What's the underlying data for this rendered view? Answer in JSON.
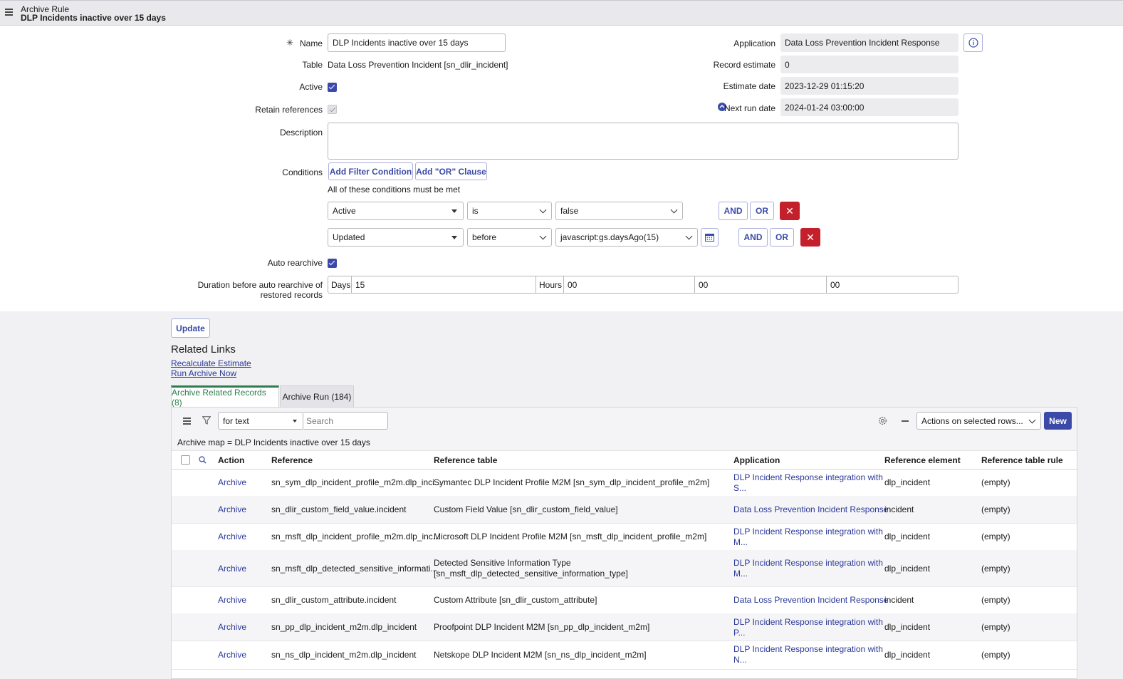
{
  "header": {
    "title_line1": "Archive Rule",
    "title_line2": "DLP Incidents inactive over 15 days",
    "menu_icon": "hamburger-menu-icon"
  },
  "form": {
    "required_marker": "✳",
    "name_label": "Name",
    "name_value": "DLP Incidents inactive over 15 days",
    "table_label": "Table",
    "table_value": "Data Loss Prevention Incident [sn_dlir_incident]",
    "active_label": "Active",
    "active_checked": true,
    "retain_label": "Retain references",
    "retain_checked": true,
    "description_label": "Description",
    "description_value": "",
    "application_label": "Application",
    "application_value": "Data Loss Prevention Incident Response",
    "record_estimate_label": "Record estimate",
    "record_estimate_value": "0",
    "estimate_date_label": "Estimate date",
    "estimate_date_value": "2023-12-29 01:15:20",
    "next_run_label": "Next run date",
    "next_run_value": "2024-01-24 03:00:00",
    "conditions_label": "Conditions",
    "add_filter_label": "Add Filter Condition",
    "add_or_label": "Add \"OR\" Clause",
    "conditions_note": "All of these conditions must be met",
    "conditions": [
      {
        "field": "Active",
        "operator": "is",
        "value": "false"
      },
      {
        "field": "Updated",
        "operator": "before",
        "value": "javascript:gs.daysAgo(15)"
      }
    ],
    "and_label": "AND",
    "or_label": "OR",
    "remove_icon": "✕",
    "auto_rearchive_label": "Auto rearchive",
    "auto_rearchive_checked": true,
    "duration_label_line1": "Duration before auto rearchive of",
    "duration_label_line2": "restored records",
    "days_label": "Days",
    "days_value": "15",
    "hours_label": "Hours",
    "hours_value": "00",
    "minutes_value": "00",
    "seconds_value": "00"
  },
  "update_label": "Update",
  "related_links": {
    "title": "Related Links",
    "links": [
      "Recalculate Estimate",
      "Run Archive Now"
    ]
  },
  "tabs": [
    {
      "label": "Archive Related Records (8)"
    },
    {
      "label": "Archive Run (184)"
    }
  ],
  "list": {
    "search_field": "for text",
    "search_placeholder": "Search",
    "actions_select": "Actions on selected rows...",
    "new_label": "New",
    "breadcrumb": "Archive map = DLP Incidents inactive over 15 days",
    "columns": [
      "Action",
      "Reference",
      "Reference table",
      "Application",
      "Reference element",
      "Reference table rule"
    ],
    "rows": [
      {
        "action": "Archive",
        "reference": "sn_sym_dlp_incident_profile_m2m.dlp_inci...",
        "ref_table": "Symantec DLP Incident Profile M2M [sn_sym_dlp_incident_profile_m2m]",
        "ref_table2": "",
        "app": "DLP Incident Response integration with",
        "app2": "S...",
        "element": "dlp_incident",
        "rule": "(empty)"
      },
      {
        "action": "Archive",
        "reference": "sn_dlir_custom_field_value.incident",
        "ref_table": "Custom Field Value [sn_dlir_custom_field_value]",
        "ref_table2": "",
        "app": "Data Loss Prevention Incident Response",
        "app2": "",
        "element": "incident",
        "rule": "(empty)"
      },
      {
        "action": "Archive",
        "reference": "sn_msft_dlp_incident_profile_m2m.dlp_inc...",
        "ref_table": "Microsoft DLP Incident Profile M2M [sn_msft_dlp_incident_profile_m2m]",
        "ref_table2": "",
        "app": "DLP Incident Response integration with",
        "app2": "M...",
        "element": "dlp_incident",
        "rule": "(empty)"
      },
      {
        "action": "Archive",
        "reference": "sn_msft_dlp_detected_sensitive_informati...",
        "ref_table": "Detected Sensitive Information Type",
        "ref_table2": "[sn_msft_dlp_detected_sensitive_information_type]",
        "app": "DLP Incident Response integration with",
        "app2": "M...",
        "element": "dlp_incident",
        "rule": "(empty)"
      },
      {
        "action": "Archive",
        "reference": "sn_dlir_custom_attribute.incident",
        "ref_table": "Custom Attribute [sn_dlir_custom_attribute]",
        "ref_table2": "",
        "app": "Data Loss Prevention Incident Response",
        "app2": "",
        "element": "incident",
        "rule": "(empty)"
      },
      {
        "action": "Archive",
        "reference": "sn_pp_dlp_incident_m2m.dlp_incident",
        "ref_table": "Proofpoint DLP Incident M2M [sn_pp_dlp_incident_m2m]",
        "ref_table2": "",
        "app": "DLP Incident Response integration with",
        "app2": "P...",
        "element": "dlp_incident",
        "rule": "(empty)"
      },
      {
        "action": "Archive",
        "reference": "sn_ns_dlp_incident_m2m.dlp_incident",
        "ref_table": "Netskope DLP Incident M2M [sn_ns_dlp_incident_m2m]",
        "ref_table2": "",
        "app": "DLP Incident Response integration with",
        "app2": "N...",
        "element": "dlp_incident",
        "rule": "(empty)"
      }
    ]
  },
  "colors": {
    "primary": "#3b4aa8",
    "link": "#2a3899",
    "danger": "#c3202b",
    "tab_active": "#2e7d4f"
  }
}
